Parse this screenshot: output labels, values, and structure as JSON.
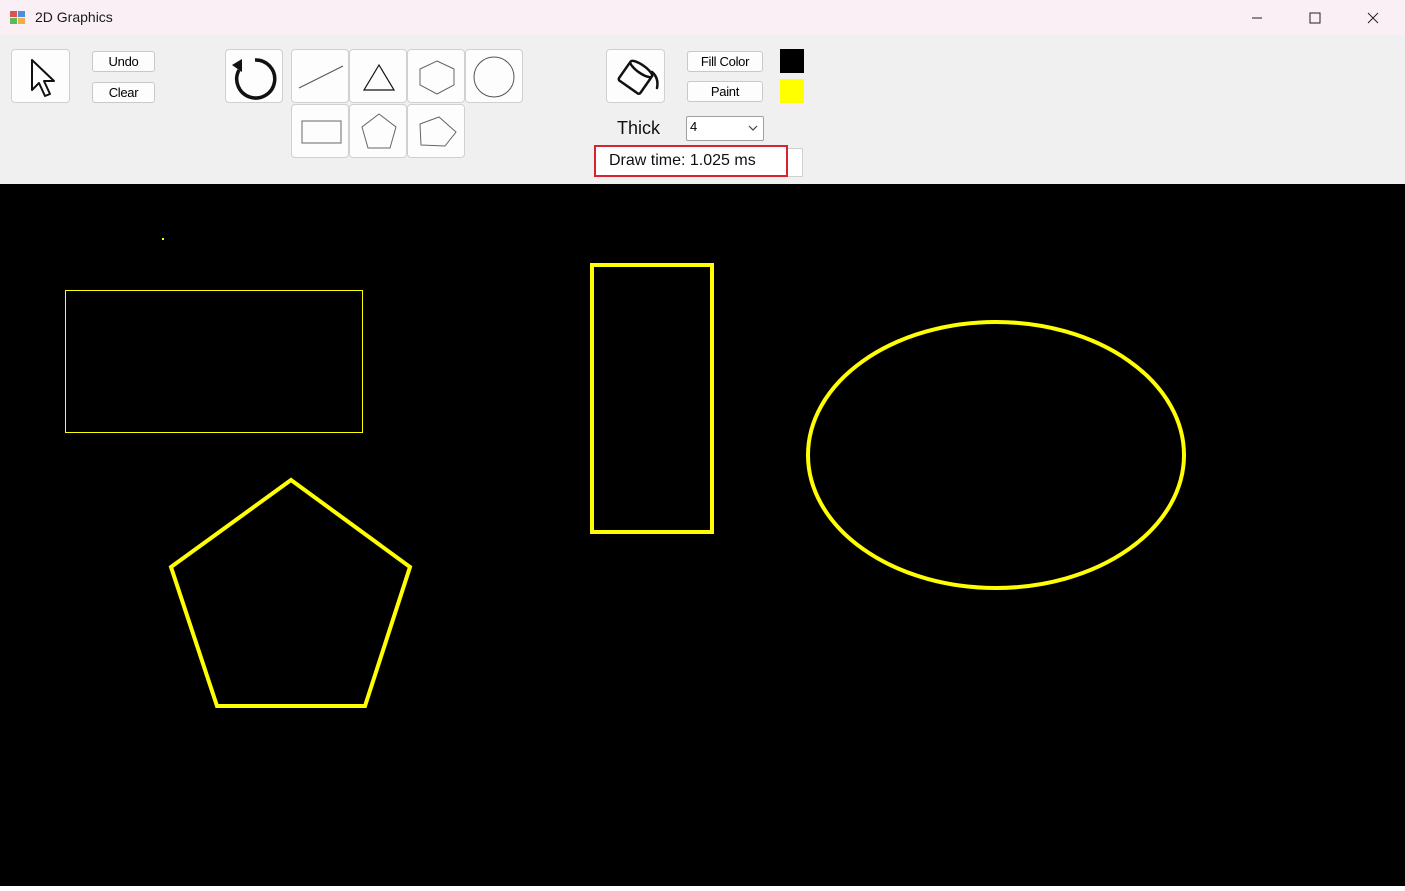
{
  "window": {
    "title": "2D Graphics"
  },
  "toolbar": {
    "undo_label": "Undo",
    "clear_label": "Clear",
    "fill_color_label": "Fill Color",
    "paint_label": "Paint",
    "thick_label": "Thick",
    "thickness_value": "4",
    "draw_time": "Draw time: 1.025 ms",
    "tools": [
      "select-arrow",
      "rotate",
      "line",
      "triangle",
      "hexagon",
      "circle",
      "rectangle",
      "pentagon",
      "irregular-pentagon",
      "paint-bucket"
    ],
    "fill_color": "#000000",
    "paint_color": "#ffff00"
  },
  "canvas": {
    "background": "#000000",
    "shapes": [
      "point",
      "rectangle",
      "rectangle",
      "ellipse",
      "pentagon"
    ],
    "stroke_color": "#ffff00"
  }
}
